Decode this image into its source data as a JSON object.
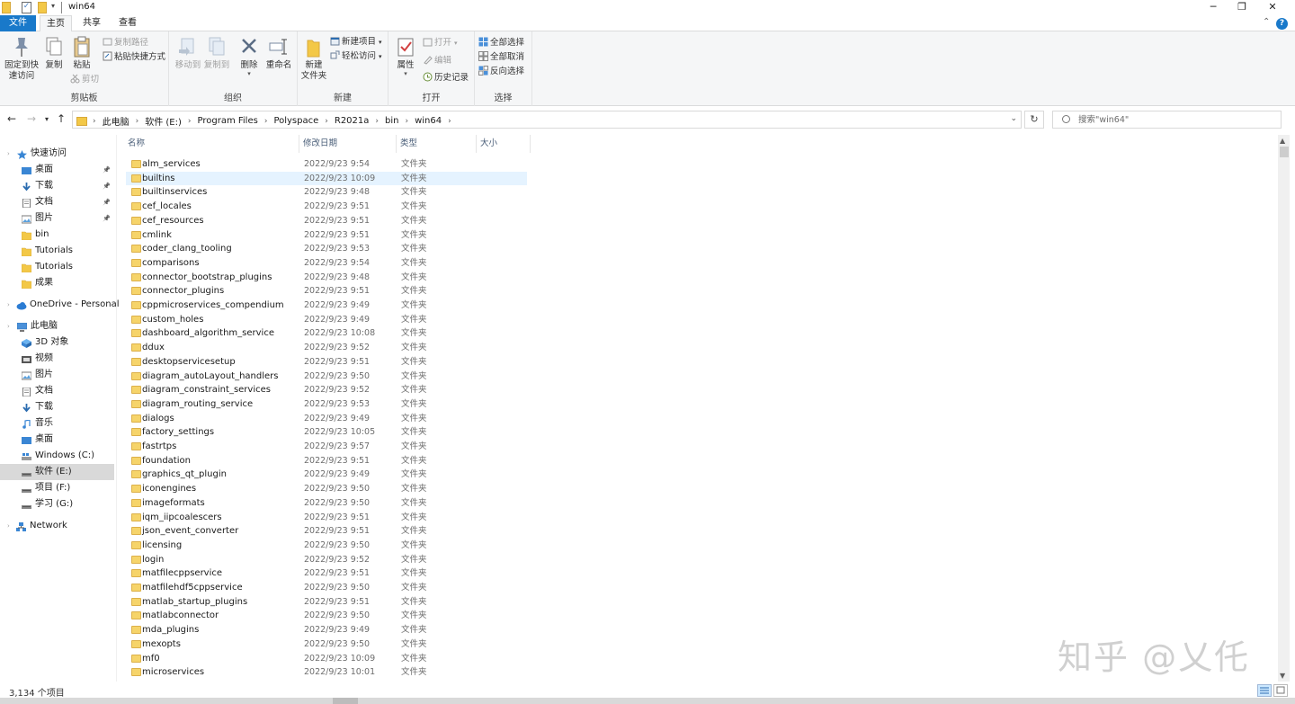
{
  "window": {
    "title": "win64"
  },
  "ribbon_tabs": {
    "file": "文件",
    "home": "主页",
    "share": "共享",
    "view": "查看"
  },
  "ribbon": {
    "clipboard": {
      "label": "剪贴板",
      "pin": "固定到快\n速访问",
      "copy": "复制",
      "paste": "粘贴",
      "copy_path": "复制路径",
      "paste_shortcut": "粘贴快捷方式",
      "cut": "剪切"
    },
    "organize": {
      "label": "组织",
      "move_to": "移动到",
      "copy_to": "复制到",
      "delete": "删除",
      "rename": "重命名"
    },
    "new": {
      "label": "新建",
      "new_folder": "新建\n文件夹",
      "new_item": "新建项目",
      "easy_access": "轻松访问"
    },
    "open": {
      "label": "打开",
      "properties": "属性",
      "open": "打开",
      "edit": "编辑",
      "history": "历史记录"
    },
    "select": {
      "label": "选择",
      "select_all": "全部选择",
      "select_none": "全部取消",
      "invert": "反向选择"
    }
  },
  "address": {
    "crumbs": [
      "此电脑",
      "软件 (E:)",
      "Program Files",
      "Polyspace",
      "R2021a",
      "bin",
      "win64"
    ]
  },
  "search": {
    "placeholder": "搜索\"win64\""
  },
  "nav": {
    "quick_access": "快速访问",
    "pinned": [
      {
        "label": "桌面",
        "icon": "desktop-icon"
      },
      {
        "label": "下载",
        "icon": "download-icon"
      },
      {
        "label": "文档",
        "icon": "documents-icon"
      },
      {
        "label": "图片",
        "icon": "pictures-icon"
      }
    ],
    "recent": [
      {
        "label": "bin"
      },
      {
        "label": "Tutorials"
      },
      {
        "label": "Tutorials"
      },
      {
        "label": "成果"
      }
    ],
    "onedrive": "OneDrive - Personal",
    "this_pc": "此电脑",
    "pc_items": [
      {
        "label": "3D 对象",
        "icon": "3d-objects-icon"
      },
      {
        "label": "视频",
        "icon": "videos-icon"
      },
      {
        "label": "图片",
        "icon": "pictures-icon"
      },
      {
        "label": "文档",
        "icon": "documents-icon"
      },
      {
        "label": "下载",
        "icon": "download-icon"
      },
      {
        "label": "音乐",
        "icon": "music-icon"
      },
      {
        "label": "桌面",
        "icon": "desktop-icon"
      },
      {
        "label": "Windows (C:)",
        "icon": "windows-drive-icon"
      },
      {
        "label": "软件 (E:)",
        "icon": "drive-icon"
      },
      {
        "label": "项目 (F:)",
        "icon": "drive-icon"
      },
      {
        "label": "学习 (G:)",
        "icon": "drive-icon"
      }
    ],
    "network": "Network"
  },
  "list": {
    "columns": {
      "name": "名称",
      "date": "修改日期",
      "type": "类型",
      "size": "大小"
    },
    "rows": [
      {
        "name": "alm_services",
        "date": "2022/9/23 9:54",
        "type": "文件夹"
      },
      {
        "name": "builtins",
        "date": "2022/9/23 10:09",
        "type": "文件夹"
      },
      {
        "name": "builtinservices",
        "date": "2022/9/23 9:48",
        "type": "文件夹"
      },
      {
        "name": "cef_locales",
        "date": "2022/9/23 9:51",
        "type": "文件夹"
      },
      {
        "name": "cef_resources",
        "date": "2022/9/23 9:51",
        "type": "文件夹"
      },
      {
        "name": "cmlink",
        "date": "2022/9/23 9:51",
        "type": "文件夹"
      },
      {
        "name": "coder_clang_tooling",
        "date": "2022/9/23 9:53",
        "type": "文件夹"
      },
      {
        "name": "comparisons",
        "date": "2022/9/23 9:54",
        "type": "文件夹"
      },
      {
        "name": "connector_bootstrap_plugins",
        "date": "2022/9/23 9:48",
        "type": "文件夹"
      },
      {
        "name": "connector_plugins",
        "date": "2022/9/23 9:51",
        "type": "文件夹"
      },
      {
        "name": "cppmicroservices_compendium",
        "date": "2022/9/23 9:49",
        "type": "文件夹"
      },
      {
        "name": "custom_holes",
        "date": "2022/9/23 9:49",
        "type": "文件夹"
      },
      {
        "name": "dashboard_algorithm_service",
        "date": "2022/9/23 10:08",
        "type": "文件夹"
      },
      {
        "name": "ddux",
        "date": "2022/9/23 9:52",
        "type": "文件夹"
      },
      {
        "name": "desktopservicesetup",
        "date": "2022/9/23 9:51",
        "type": "文件夹"
      },
      {
        "name": "diagram_autoLayout_handlers",
        "date": "2022/9/23 9:50",
        "type": "文件夹"
      },
      {
        "name": "diagram_constraint_services",
        "date": "2022/9/23 9:52",
        "type": "文件夹"
      },
      {
        "name": "diagram_routing_service",
        "date": "2022/9/23 9:53",
        "type": "文件夹"
      },
      {
        "name": "dialogs",
        "date": "2022/9/23 9:49",
        "type": "文件夹"
      },
      {
        "name": "factory_settings",
        "date": "2022/9/23 10:05",
        "type": "文件夹"
      },
      {
        "name": "fastrtps",
        "date": "2022/9/23 9:57",
        "type": "文件夹"
      },
      {
        "name": "foundation",
        "date": "2022/9/23 9:51",
        "type": "文件夹"
      },
      {
        "name": "graphics_qt_plugin",
        "date": "2022/9/23 9:49",
        "type": "文件夹"
      },
      {
        "name": "iconengines",
        "date": "2022/9/23 9:50",
        "type": "文件夹"
      },
      {
        "name": "imageformats",
        "date": "2022/9/23 9:50",
        "type": "文件夹"
      },
      {
        "name": "iqm_iipcoalescers",
        "date": "2022/9/23 9:51",
        "type": "文件夹"
      },
      {
        "name": "json_event_converter",
        "date": "2022/9/23 9:51",
        "type": "文件夹"
      },
      {
        "name": "licensing",
        "date": "2022/9/23 9:50",
        "type": "文件夹"
      },
      {
        "name": "login",
        "date": "2022/9/23 9:52",
        "type": "文件夹"
      },
      {
        "name": "matfilecppservice",
        "date": "2022/9/23 9:51",
        "type": "文件夹"
      },
      {
        "name": "matfilehdf5cppservice",
        "date": "2022/9/23 9:50",
        "type": "文件夹"
      },
      {
        "name": "matlab_startup_plugins",
        "date": "2022/9/23 9:51",
        "type": "文件夹"
      },
      {
        "name": "matlabconnector",
        "date": "2022/9/23 9:50",
        "type": "文件夹"
      },
      {
        "name": "mda_plugins",
        "date": "2022/9/23 9:49",
        "type": "文件夹"
      },
      {
        "name": "mexopts",
        "date": "2022/9/23 9:50",
        "type": "文件夹"
      },
      {
        "name": "mf0",
        "date": "2022/9/23 10:09",
        "type": "文件夹"
      },
      {
        "name": "microservices",
        "date": "2022/9/23 10:01",
        "type": "文件夹"
      }
    ]
  },
  "status": {
    "count": "3,134 个项目"
  },
  "watermark": "知乎 @乂仛"
}
